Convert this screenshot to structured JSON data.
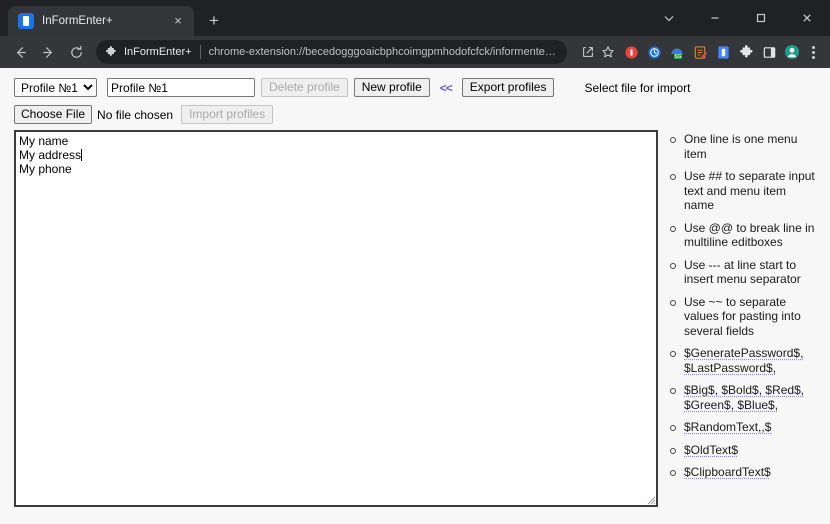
{
  "window": {
    "controls": {
      "chevron_down": "chevron-down",
      "minimize": "minimize",
      "maximize": "maximize",
      "close": "close"
    }
  },
  "tabstrip": {
    "tabs": [
      {
        "title": "InFormEnter+",
        "favicon": "informenter-icon",
        "close_label": "×"
      }
    ],
    "new_tab_label": "+"
  },
  "toolbar": {
    "back_icon": "back-arrow-icon",
    "forward_icon": "forward-arrow-icon",
    "reload_icon": "reload-icon",
    "omnibox": {
      "extension_icon": "puzzle-piece-icon",
      "extension_name": "InFormEnter+",
      "url": "chrome-extension://becedogggoaicbphcoimgpmhodofcfck/informenter-...",
      "share_icon": "share-icon",
      "bookmark_icon": "star-icon"
    },
    "extensions": [
      {
        "name": "record-extension-icon",
        "color": "#e8453c"
      },
      {
        "name": "clock-extension-icon",
        "color": "#1a73e8"
      },
      {
        "name": "sg-extension-icon",
        "color": "#3a7bd5"
      },
      {
        "name": "notes-extension-icon",
        "color": "#d9822b"
      },
      {
        "name": "informenter-extension-icon",
        "color": "#4285f4"
      },
      {
        "name": "puzzle-extensions-icon",
        "color": "#cfd1d4"
      },
      {
        "name": "sidepanel-icon",
        "color": "#cfd1d4"
      },
      {
        "name": "profile-avatar-icon",
        "color": "#1b9e8a"
      }
    ],
    "menu_icon": "three-dot-menu-icon"
  },
  "page": {
    "profile_select": {
      "selected": "Profile №1",
      "options": [
        "Profile №1"
      ]
    },
    "profile_name_input": {
      "value": "Profile №1",
      "placeholder": ""
    },
    "delete_profile_button": "Delete profile",
    "new_profile_button": "New profile",
    "collapse_link": "<<",
    "export_profiles_button": "Export profiles",
    "import_label": "Select file for import",
    "choose_file_button": "Choose File",
    "file_status": "No file chosen",
    "import_profiles_button": "Import profiles",
    "editor": {
      "lines": [
        "My name",
        "My address",
        "My phone"
      ],
      "caret_line_index": 1
    },
    "help_items": [
      {
        "text": "One line is one menu item",
        "token": false
      },
      {
        "text": "Use ## to separate input text and menu item name",
        "token": false
      },
      {
        "text": "Use @@ to break line in multiline editboxes",
        "token": false
      },
      {
        "text": "Use --- at line start to insert menu separator",
        "token": false
      },
      {
        "text": "Use ~~ to separate values for pasting into several fields",
        "token": false
      },
      {
        "text": "$GeneratePassword$, $LastPassword$,",
        "token": true
      },
      {
        "text": "$Big$, $Bold$, $Red$, $Green$, $Blue$,",
        "token": true
      },
      {
        "text": "$RandomText,,$",
        "token": true
      },
      {
        "text": "$OldText$",
        "token": true
      },
      {
        "text": "$ClipboardText$",
        "token": true
      }
    ]
  },
  "colors": {
    "chrome_bg": "#202124",
    "toolbar_bg": "#35363a",
    "tab_active": "#323639",
    "page_bg": "#f7f7f7",
    "link": "#6a5acd",
    "editor_border": "#3c3c3c"
  }
}
